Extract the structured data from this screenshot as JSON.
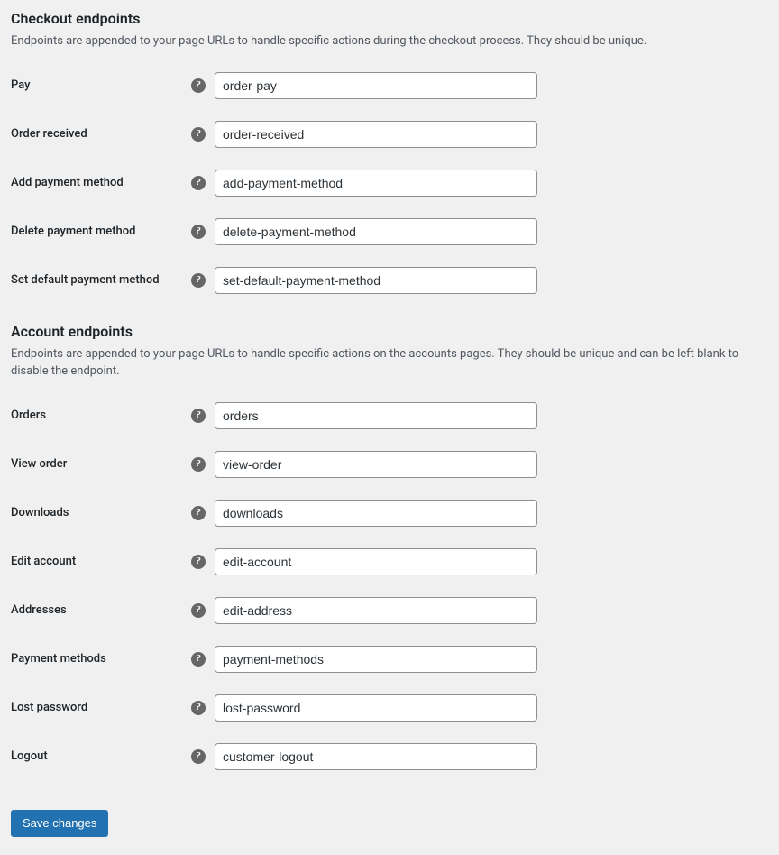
{
  "checkout_section": {
    "heading": "Checkout endpoints",
    "description": "Endpoints are appended to your page URLs to handle specific actions during the checkout process. They should be unique.",
    "fields": {
      "pay": {
        "label": "Pay",
        "value": "order-pay"
      },
      "order_received": {
        "label": "Order received",
        "value": "order-received"
      },
      "add_payment_method": {
        "label": "Add payment method",
        "value": "add-payment-method"
      },
      "delete_payment_method": {
        "label": "Delete payment method",
        "value": "delete-payment-method"
      },
      "set_default_payment_method": {
        "label": "Set default payment method",
        "value": "set-default-payment-method"
      }
    }
  },
  "account_section": {
    "heading": "Account endpoints",
    "description": "Endpoints are appended to your page URLs to handle specific actions on the accounts pages. They should be unique and can be left blank to disable the endpoint.",
    "fields": {
      "orders": {
        "label": "Orders",
        "value": "orders"
      },
      "view_order": {
        "label": "View order",
        "value": "view-order"
      },
      "downloads": {
        "label": "Downloads",
        "value": "downloads"
      },
      "edit_account": {
        "label": "Edit account",
        "value": "edit-account"
      },
      "addresses": {
        "label": "Addresses",
        "value": "edit-address"
      },
      "payment_methods": {
        "label": "Payment methods",
        "value": "payment-methods"
      },
      "lost_password": {
        "label": "Lost password",
        "value": "lost-password"
      },
      "logout": {
        "label": "Logout",
        "value": "customer-logout"
      }
    }
  },
  "save_button": {
    "label": "Save changes"
  },
  "help_glyph": "?"
}
